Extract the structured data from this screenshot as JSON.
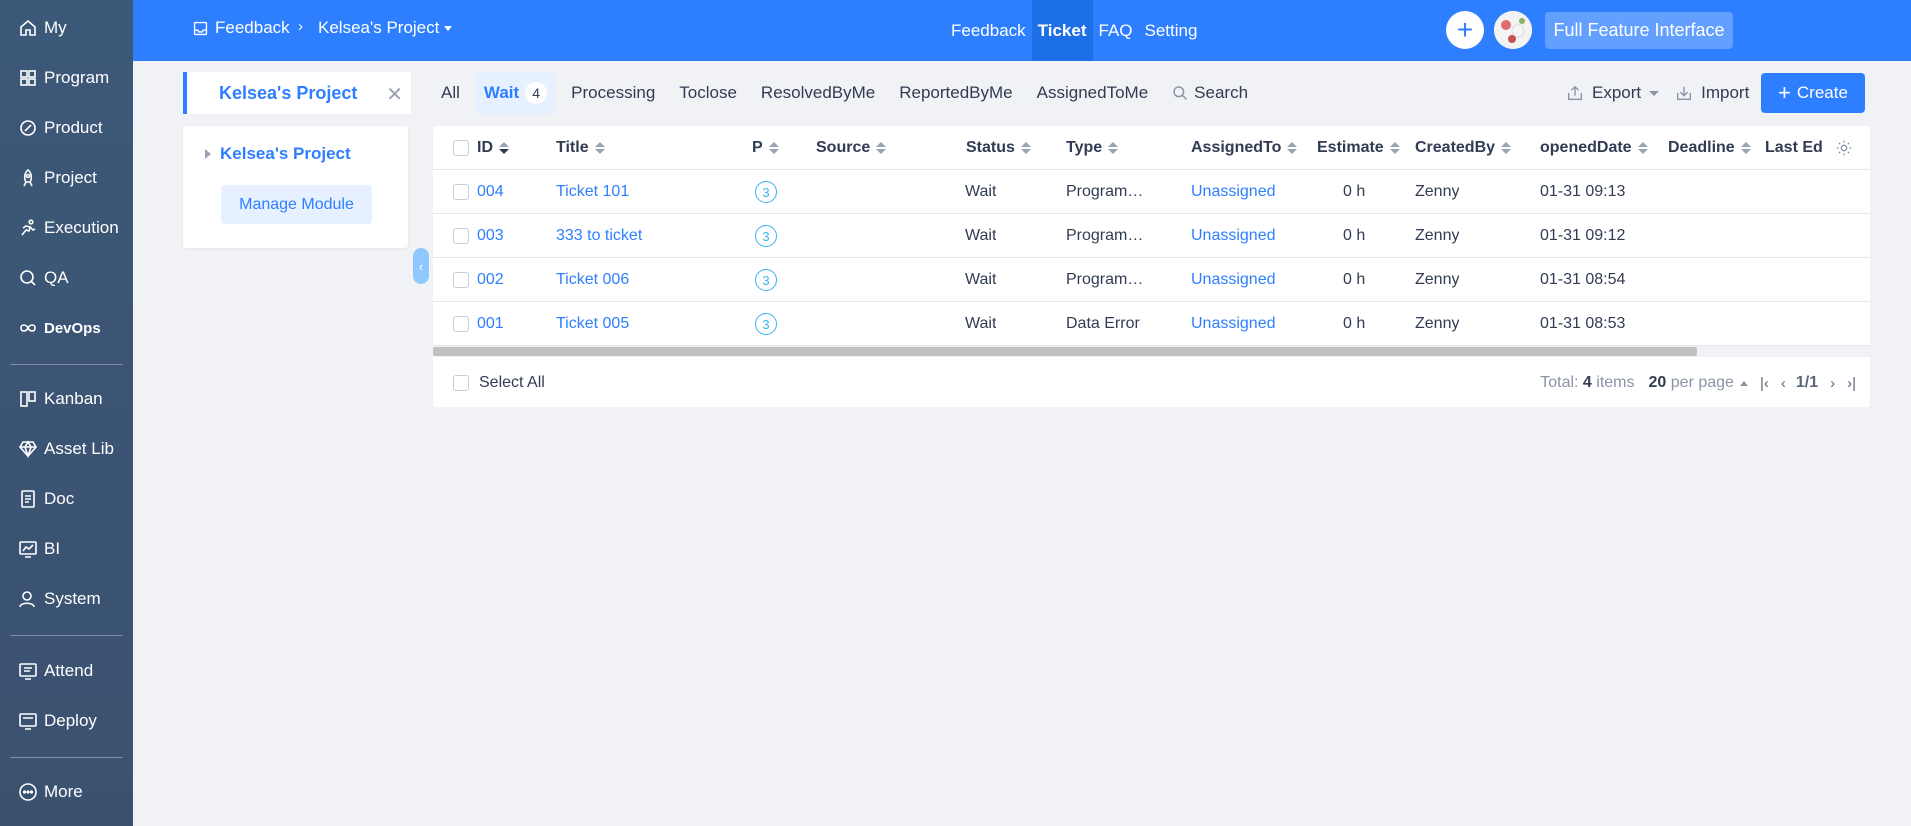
{
  "sidebar": {
    "items": [
      {
        "label": "My",
        "icon": "home-icon"
      },
      {
        "label": "Program",
        "icon": "grid-icon"
      },
      {
        "label": "Product",
        "icon": "product-icon"
      },
      {
        "label": "Project",
        "icon": "rocket-icon"
      },
      {
        "label": "Execution",
        "icon": "run-icon"
      },
      {
        "label": "QA",
        "icon": "qa-search-icon"
      },
      {
        "label": "DevOps",
        "icon": "infinity-icon"
      },
      {
        "label": "Kanban",
        "icon": "kanban-icon"
      },
      {
        "label": "Asset Lib",
        "icon": "diamond-icon"
      },
      {
        "label": "Doc",
        "icon": "doc-icon"
      },
      {
        "label": "BI",
        "icon": "chart-icon"
      },
      {
        "label": "System",
        "icon": "user-icon"
      },
      {
        "label": "Attend",
        "icon": "attend-icon"
      },
      {
        "label": "Deploy",
        "icon": "deploy-icon"
      },
      {
        "label": "More",
        "icon": "more-icon"
      }
    ]
  },
  "header": {
    "breadcrumb_root": "Feedback",
    "breadcrumb_project": "Kelsea's Project",
    "tabs": [
      "Feedback",
      "Ticket",
      "FAQ",
      "Setting"
    ],
    "active_tab": "Ticket",
    "full_feature_label": "Full Feature Interface"
  },
  "project_panel": {
    "tab_name": "Kelsea's Project",
    "tree_node": "Kelsea's Project",
    "manage_label": "Manage Module"
  },
  "filters": {
    "tabs": [
      {
        "label": "All"
      },
      {
        "label": "Wait",
        "count": "4",
        "active": true
      },
      {
        "label": "Processing"
      },
      {
        "label": "Toclose"
      },
      {
        "label": "ResolvedByMe"
      },
      {
        "label": "ReportedByMe"
      },
      {
        "label": "AssignedToMe"
      }
    ],
    "search_label": "Search",
    "export_label": "Export",
    "import_label": "Import",
    "create_label": "Create"
  },
  "table": {
    "columns": [
      "ID",
      "Title",
      "P",
      "Source",
      "Status",
      "Type",
      "AssignedTo",
      "Estimate",
      "CreatedBy",
      "openedDate",
      "Deadline",
      "Last Edi"
    ],
    "rows": [
      {
        "id": "004",
        "title": "Ticket 101",
        "p": "3",
        "source": "",
        "status": "Wait",
        "type": "Program…",
        "assigned": "Unassigned",
        "estimate": "0 h",
        "created_by": "Zenny",
        "opened": "01-31 09:13"
      },
      {
        "id": "003",
        "title": "333 to ticket",
        "p": "3",
        "source": "",
        "status": "Wait",
        "type": "Program…",
        "assigned": "Unassigned",
        "estimate": "0 h",
        "created_by": "Zenny",
        "opened": "01-31 09:12"
      },
      {
        "id": "002",
        "title": "Ticket 006",
        "p": "3",
        "source": "",
        "status": "Wait",
        "type": "Program…",
        "assigned": "Unassigned",
        "estimate": "0 h",
        "created_by": "Zenny",
        "opened": "01-31 08:54"
      },
      {
        "id": "001",
        "title": "Ticket 005",
        "p": "3",
        "source": "",
        "status": "Wait",
        "type": "Data Error",
        "assigned": "Unassigned",
        "estimate": "0 h",
        "created_by": "Zenny",
        "opened": "01-31 08:53"
      }
    ],
    "select_all_label": "Select All",
    "total_prefix": "Total:",
    "total_count": "4",
    "total_suffix": "items",
    "per_page_value": "20",
    "per_page_label": "per page",
    "page_indicator": "1/1"
  },
  "colors": {
    "brand": "#2e7fff",
    "sidebar": "#3b5375",
    "priority": "#38b2f0"
  }
}
